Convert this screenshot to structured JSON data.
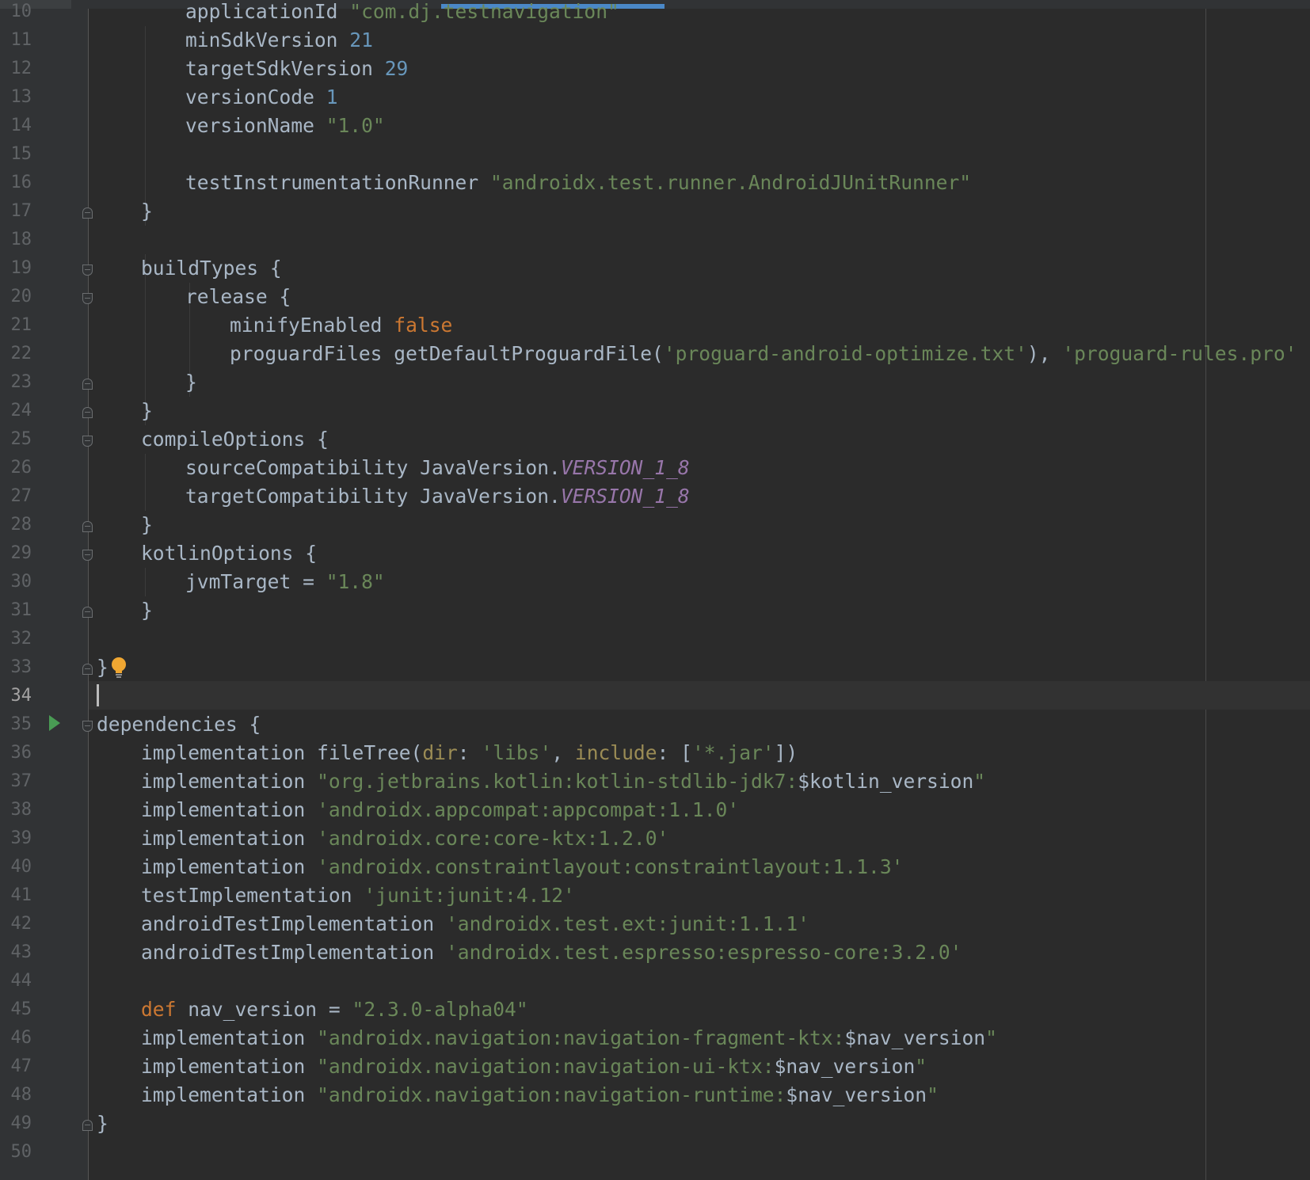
{
  "editor": {
    "lines": [
      {
        "number": "10",
        "tokens": [
          {
            "t": "applicationId ",
            "c": "plain"
          },
          {
            "t": "\"com.dj.testnavigation\"",
            "c": "str"
          }
        ]
      },
      {
        "number": "11",
        "tokens": [
          {
            "t": "minSdkVersion ",
            "c": "plain"
          },
          {
            "t": "21",
            "c": "num"
          }
        ]
      },
      {
        "number": "12",
        "tokens": [
          {
            "t": "targetSdkVersion ",
            "c": "plain"
          },
          {
            "t": "29",
            "c": "num"
          }
        ]
      },
      {
        "number": "13",
        "tokens": [
          {
            "t": "versionCode ",
            "c": "plain"
          },
          {
            "t": "1",
            "c": "num"
          }
        ]
      },
      {
        "number": "14",
        "tokens": [
          {
            "t": "versionName ",
            "c": "plain"
          },
          {
            "t": "\"1.0\"",
            "c": "str"
          }
        ]
      },
      {
        "number": "15",
        "tokens": []
      },
      {
        "number": "16",
        "tokens": [
          {
            "t": "testInstrumentationRunner ",
            "c": "plain"
          },
          {
            "t": "\"androidx.test.runner.AndroidJUnitRunner\"",
            "c": "str"
          }
        ]
      },
      {
        "number": "17",
        "tokens": [
          {
            "t": "}",
            "c": "plain"
          }
        ]
      },
      {
        "number": "18",
        "tokens": []
      },
      {
        "number": "19",
        "tokens": [
          {
            "t": "buildTypes {",
            "c": "plain"
          }
        ]
      },
      {
        "number": "20",
        "tokens": [
          {
            "t": "release {",
            "c": "plain"
          }
        ]
      },
      {
        "number": "21",
        "tokens": [
          {
            "t": "minifyEnabled ",
            "c": "plain"
          },
          {
            "t": "false",
            "c": "kw"
          }
        ]
      },
      {
        "number": "22",
        "tokens": [
          {
            "t": "proguardFiles getDefaultProguardFile(",
            "c": "plain"
          },
          {
            "t": "'proguard-android-optimize.txt'",
            "c": "str"
          },
          {
            "t": "), ",
            "c": "plain"
          },
          {
            "t": "'proguard-rules.pro'",
            "c": "str"
          }
        ]
      },
      {
        "number": "23",
        "tokens": [
          {
            "t": "}",
            "c": "plain"
          }
        ]
      },
      {
        "number": "24",
        "tokens": [
          {
            "t": "}",
            "c": "plain"
          }
        ]
      },
      {
        "number": "25",
        "tokens": [
          {
            "t": "compileOptions {",
            "c": "plain"
          }
        ]
      },
      {
        "number": "26",
        "tokens": [
          {
            "t": "sourceCompatibility JavaVersion.",
            "c": "plain"
          },
          {
            "t": "VERSION_1_8",
            "c": "const"
          }
        ]
      },
      {
        "number": "27",
        "tokens": [
          {
            "t": "targetCompatibility JavaVersion.",
            "c": "plain"
          },
          {
            "t": "VERSION_1_8",
            "c": "const"
          }
        ]
      },
      {
        "number": "28",
        "tokens": [
          {
            "t": "}",
            "c": "plain"
          }
        ]
      },
      {
        "number": "29",
        "tokens": [
          {
            "t": "kotlinOptions {",
            "c": "plain"
          }
        ]
      },
      {
        "number": "30",
        "tokens": [
          {
            "t": "jvmTarget = ",
            "c": "plain"
          },
          {
            "t": "\"1.8\"",
            "c": "str"
          }
        ]
      },
      {
        "number": "31",
        "tokens": [
          {
            "t": "}",
            "c": "plain"
          }
        ]
      },
      {
        "number": "32",
        "tokens": []
      },
      {
        "number": "33",
        "tokens": [
          {
            "t": "}",
            "c": "plain"
          }
        ]
      },
      {
        "number": "34",
        "tokens": []
      },
      {
        "number": "35",
        "tokens": [
          {
            "t": "dependencies {",
            "c": "plain"
          }
        ]
      },
      {
        "number": "36",
        "tokens": [
          {
            "t": "implementation fileTree(",
            "c": "plain"
          },
          {
            "t": "dir",
            "c": "named"
          },
          {
            "t": ": ",
            "c": "plain"
          },
          {
            "t": "'libs'",
            "c": "str"
          },
          {
            "t": ", ",
            "c": "plain"
          },
          {
            "t": "include",
            "c": "named"
          },
          {
            "t": ": [",
            "c": "plain"
          },
          {
            "t": "'*.jar'",
            "c": "str"
          },
          {
            "t": "])",
            "c": "plain"
          }
        ]
      },
      {
        "number": "37",
        "tokens": [
          {
            "t": "implementation ",
            "c": "plain"
          },
          {
            "t": "\"org.jetbrains.kotlin:kotlin-stdlib-jdk7:",
            "c": "str"
          },
          {
            "t": "$kotlin_version",
            "c": "plain"
          },
          {
            "t": "\"",
            "c": "str"
          }
        ]
      },
      {
        "number": "38",
        "tokens": [
          {
            "t": "implementation ",
            "c": "plain"
          },
          {
            "t": "'androidx.appcompat:appcompat:1.1.0'",
            "c": "str"
          }
        ]
      },
      {
        "number": "39",
        "tokens": [
          {
            "t": "implementation ",
            "c": "plain"
          },
          {
            "t": "'androidx.core:core-ktx:1.2.0'",
            "c": "str"
          }
        ]
      },
      {
        "number": "40",
        "tokens": [
          {
            "t": "implementation ",
            "c": "plain"
          },
          {
            "t": "'androidx.constraintlayout:constraintlayout:1.1.3'",
            "c": "str"
          }
        ]
      },
      {
        "number": "41",
        "tokens": [
          {
            "t": "testImplementation ",
            "c": "plain"
          },
          {
            "t": "'junit:junit:4.12'",
            "c": "str"
          }
        ]
      },
      {
        "number": "42",
        "tokens": [
          {
            "t": "androidTestImplementation ",
            "c": "plain"
          },
          {
            "t": "'androidx.test.ext:junit:1.1.1'",
            "c": "str"
          }
        ]
      },
      {
        "number": "43",
        "tokens": [
          {
            "t": "androidTestImplementation ",
            "c": "plain"
          },
          {
            "t": "'androidx.test.espresso:espresso-core:3.2.0'",
            "c": "str"
          }
        ]
      },
      {
        "number": "44",
        "tokens": []
      },
      {
        "number": "45",
        "tokens": [
          {
            "t": "def",
            "c": "kw"
          },
          {
            "t": " nav_version = ",
            "c": "plain"
          },
          {
            "t": "\"2.3.0-alpha04\"",
            "c": "str"
          }
        ]
      },
      {
        "number": "46",
        "tokens": [
          {
            "t": "implementation ",
            "c": "plain"
          },
          {
            "t": "\"androidx.navigation:navigation-fragment-ktx:",
            "c": "str"
          },
          {
            "t": "$nav_version",
            "c": "plain"
          },
          {
            "t": "\"",
            "c": "str"
          }
        ]
      },
      {
        "number": "47",
        "tokens": [
          {
            "t": "implementation ",
            "c": "plain"
          },
          {
            "t": "\"androidx.navigation:navigation-ui-ktx:",
            "c": "str"
          },
          {
            "t": "$nav_version",
            "c": "plain"
          },
          {
            "t": "\"",
            "c": "str"
          }
        ]
      },
      {
        "number": "48",
        "tokens": [
          {
            "t": "implementation ",
            "c": "plain"
          },
          {
            "t": "\"androidx.navigation:navigation-runtime:",
            "c": "str"
          },
          {
            "t": "$nav_version",
            "c": "plain"
          },
          {
            "t": "\"",
            "c": "str"
          }
        ]
      },
      {
        "number": "49",
        "tokens": [
          {
            "t": "}",
            "c": "plain"
          }
        ]
      },
      {
        "number": "50",
        "tokens": []
      }
    ],
    "current_line": "34",
    "icons": {
      "run": "run-gutter-icon",
      "bulb": "intention-bulb-icon"
    },
    "colors": {
      "background": "#2b2b2b",
      "text": "#a9b7c6",
      "keyword": "#cc7832",
      "number": "#6897bb",
      "string": "#6a8759",
      "constant": "#9876aa",
      "named_arg": "#9b8c55",
      "line_number": "#606366"
    }
  }
}
